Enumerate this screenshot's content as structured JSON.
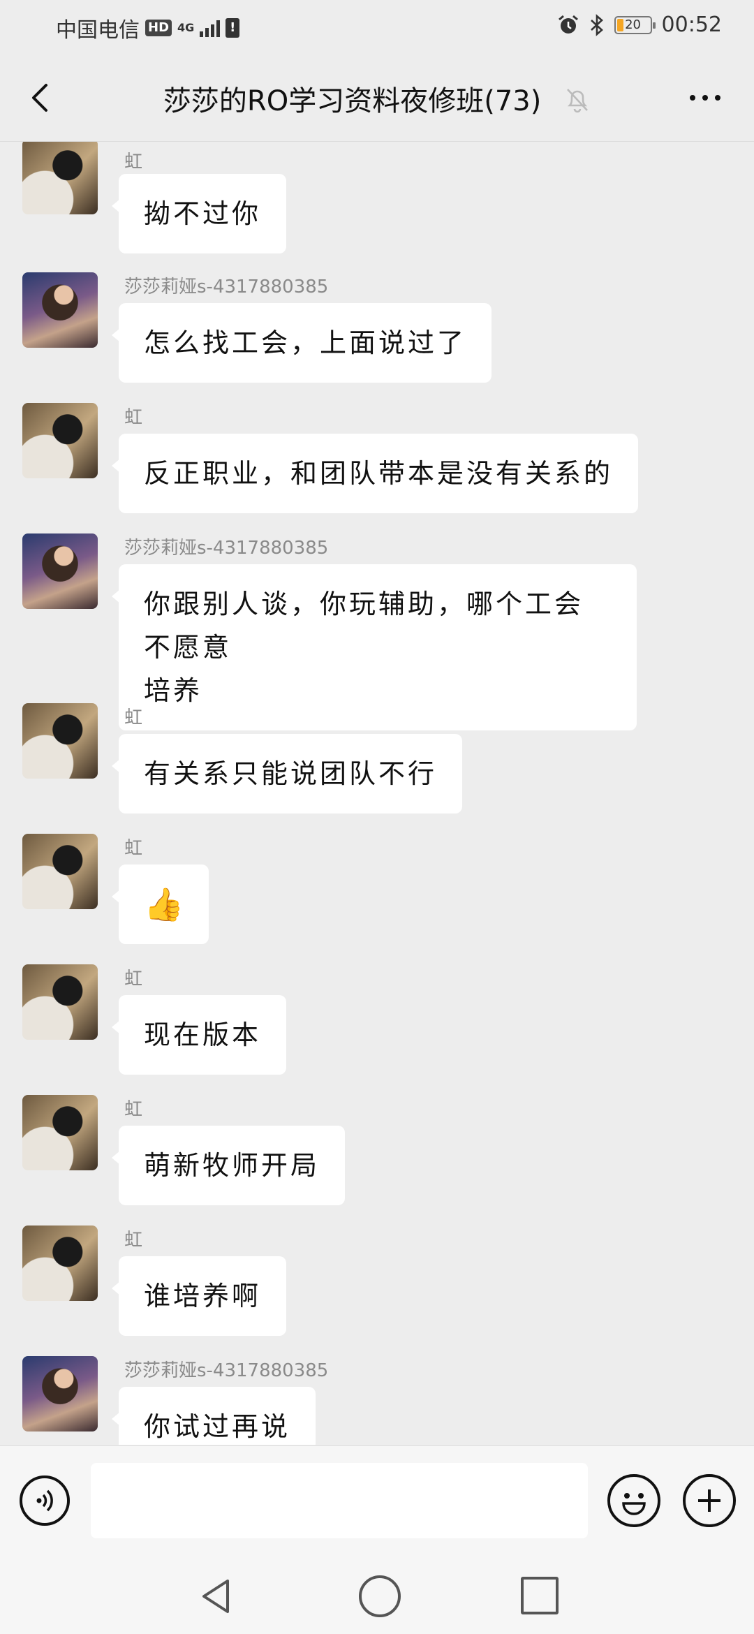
{
  "status_bar": {
    "carrier": "中国电信",
    "hd": "HD",
    "network": "4G",
    "sim_alert": "!",
    "battery_level": "20",
    "time": "00:52"
  },
  "header": {
    "title": "莎莎的RO学习资料夜修班(73)"
  },
  "messages": [
    {
      "sender": "虹",
      "text": "拗不过你",
      "avatar": "cat"
    },
    {
      "sender": "莎莎莉娅s-4317880385",
      "text": "怎么找工会，上面说过了",
      "avatar": "girl"
    },
    {
      "sender": "虹",
      "text": "反正职业，和团队带本是没有关系的",
      "avatar": "cat"
    },
    {
      "sender": "莎莎莉娅s-4317880385",
      "text_line1": "你跟别人谈，你玩辅助，哪个工会不愿意",
      "text_line2": "培养",
      "avatar": "girl"
    },
    {
      "sender": "虹",
      "text": "有关系只能说团队不行",
      "avatar": "cat"
    },
    {
      "sender": "虹",
      "text": "👍",
      "avatar": "cat"
    },
    {
      "sender": "虹",
      "text": "现在版本",
      "avatar": "cat"
    },
    {
      "sender": "虹",
      "text": "萌新牧师开局",
      "avatar": "cat"
    },
    {
      "sender": "虹",
      "text": "谁培养啊",
      "avatar": "cat"
    },
    {
      "sender": "莎莎莉娅s-4317880385",
      "text": "你试过再说",
      "avatar": "girl"
    }
  ],
  "input": {
    "value": "",
    "placeholder": ""
  },
  "colors": {
    "background": "#ededed",
    "bubble": "#ffffff",
    "sender_text": "#8a8a8a",
    "battery_low": "#f5a623"
  },
  "icons": {
    "back": "chevron-left-icon",
    "mute": "bell-off-icon",
    "more": "more-horizontal-icon",
    "voice": "voice-icon",
    "emoji": "smile-icon",
    "plus": "plus-icon"
  }
}
